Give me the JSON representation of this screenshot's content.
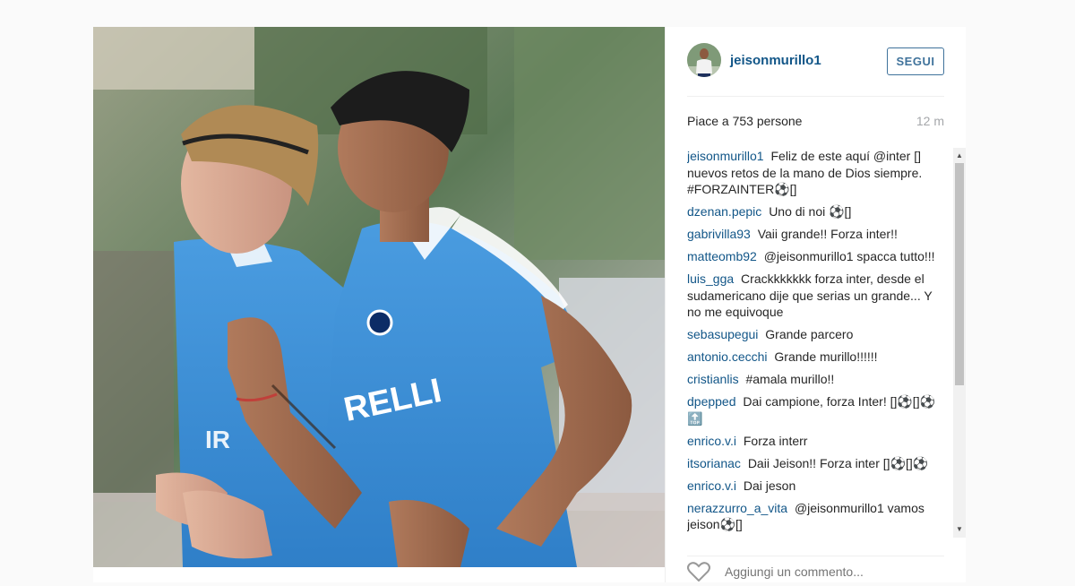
{
  "post": {
    "username": "jeisonmurillo1",
    "follow_label": "SEGUI",
    "likes_text": "Piace a 753 persone",
    "time_ago": "12 m",
    "add_comment_placeholder": "Aggiungi un commento..."
  },
  "comments": [
    {
      "user": "jeisonmurillo1",
      "text": "Feliz de este aquí @inter [] nuevos retos de la mano de Dios siempre. #FORZAINTER⚽[]"
    },
    {
      "user": "dzenan.pepic",
      "text": "Uno di noi ⚽[]"
    },
    {
      "user": "gabrivilla93",
      "text": "Vaii grande!! Forza inter!!"
    },
    {
      "user": "matteomb92",
      "text": "@jeisonmurillo1 spacca tutto!!!"
    },
    {
      "user": "luis_gga",
      "text": "Crackkkkkkk forza inter, desde el sudamericano dije que serias un grande... Y no me equivoque"
    },
    {
      "user": "sebasupegui",
      "text": "Grande parcero"
    },
    {
      "user": "antonio.cecchi",
      "text": "Grande murillo!!!!!!"
    },
    {
      "user": "cristianlis",
      "text": "#amala murillo!!"
    },
    {
      "user": "dpepped",
      "text": "Dai campione, forza Inter! []⚽[]⚽🔝"
    },
    {
      "user": "enrico.v.i",
      "text": "Forza interr"
    },
    {
      "user": "itsorianac",
      "text": "Daii Jeison!! Forza inter []⚽[]⚽"
    },
    {
      "user": "enrico.v.i",
      "text": "Dai jeson"
    },
    {
      "user": "nerazzurro_a_vita",
      "text": "@jeisonmurillo1 vamos jeison⚽[]"
    }
  ],
  "icons": {
    "avatar": "user-avatar",
    "heart": "heart-icon",
    "scroll_up": "scroll-up-arrow",
    "scroll_down": "scroll-down-arrow"
  },
  "colors": {
    "username": "#125688",
    "button": "#3f729b",
    "meta": "#a5a7aa",
    "background": "#fafafa"
  }
}
